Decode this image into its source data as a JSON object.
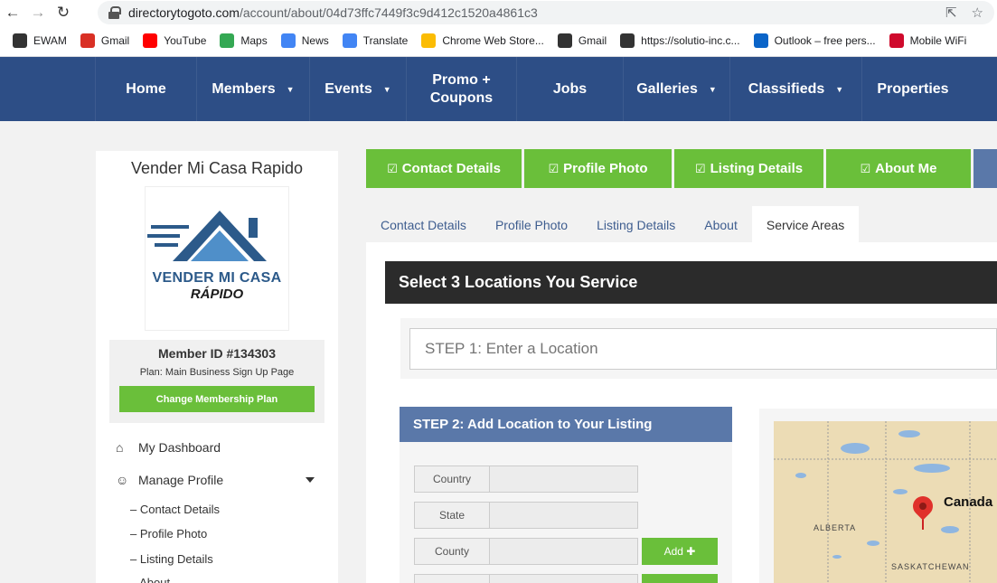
{
  "browser": {
    "url_host": "directorytogoto.com",
    "url_path": "/account/about/04d73ffc7449f3c9d412c1520a4861c3",
    "bookmarks": [
      {
        "label": "EWAM",
        "icon": "globe-icon",
        "color": "#333333"
      },
      {
        "label": "Gmail",
        "icon": "gmail-icon",
        "color": "#d93025"
      },
      {
        "label": "YouTube",
        "icon": "youtube-icon",
        "color": "#ff0000"
      },
      {
        "label": "Maps",
        "icon": "maps-icon",
        "color": "#34a853"
      },
      {
        "label": "News",
        "icon": "news-icon",
        "color": "#4285f4"
      },
      {
        "label": "Translate",
        "icon": "translate-icon",
        "color": "#4285f4"
      },
      {
        "label": "Chrome Web Store...",
        "icon": "chrome-store-icon",
        "color": "#fbbc04"
      },
      {
        "label": "Gmail",
        "icon": "globe-icon",
        "color": "#333333"
      },
      {
        "label": "https://solutio-inc.c...",
        "icon": "circle-icon",
        "color": "#333333"
      },
      {
        "label": "Outlook – free pers...",
        "icon": "outlook-icon",
        "color": "#0a64c8"
      },
      {
        "label": "Mobile WiFi",
        "icon": "huawei-icon",
        "color": "#cf0a2c"
      }
    ]
  },
  "nav": {
    "items": [
      {
        "label": "Home",
        "caret": ""
      },
      {
        "label": "Members",
        "caret": "▼"
      },
      {
        "label": "Events",
        "caret": "▼"
      },
      {
        "label": "Promo +\nCoupons",
        "caret": ""
      },
      {
        "label": "Jobs",
        "caret": ""
      },
      {
        "label": "Galleries",
        "caret": "▼"
      },
      {
        "label": "Classifieds",
        "caret": "▼"
      },
      {
        "label": "Properties",
        "caret": ""
      }
    ]
  },
  "sidebar": {
    "business_name": "Vender Mi Casa Rapido",
    "logo_line1": "VENDER MI CASA",
    "logo_line2": "RÁPIDO",
    "member_id": "Member ID #134303",
    "plan": "Plan: Main Business Sign Up Page",
    "change_plan_label": "Change Membership Plan",
    "dashboard_label": "My Dashboard",
    "manage_profile_label": "Manage Profile",
    "sub_links": [
      "– Contact Details",
      "– Profile Photo",
      "– Listing Details",
      "– About"
    ]
  },
  "main": {
    "top_buttons": [
      "Contact Details",
      "Profile Photo",
      "Listing Details",
      "About Me"
    ],
    "tabs": [
      "Contact Details",
      "Profile Photo",
      "Listing Details",
      "About",
      "Service Areas"
    ],
    "active_tab": "Service Areas",
    "section_title": "Select 3 Locations You Service",
    "step1_placeholder": "STEP 1: Enter a Location",
    "step2_title": "STEP 2: Add Location to Your Listing",
    "fields": [
      {
        "label": "Country",
        "add": ""
      },
      {
        "label": "State",
        "add": ""
      },
      {
        "label": "County",
        "add": "Add ✚"
      }
    ],
    "map": {
      "country_label": "Canada",
      "region_labels": [
        "ALBERTA",
        "SASKATCHEWAN"
      ]
    },
    "colors": {
      "green": "#6abf3a",
      "blue": "#5a78a9",
      "nav": "#2d4e86"
    }
  }
}
